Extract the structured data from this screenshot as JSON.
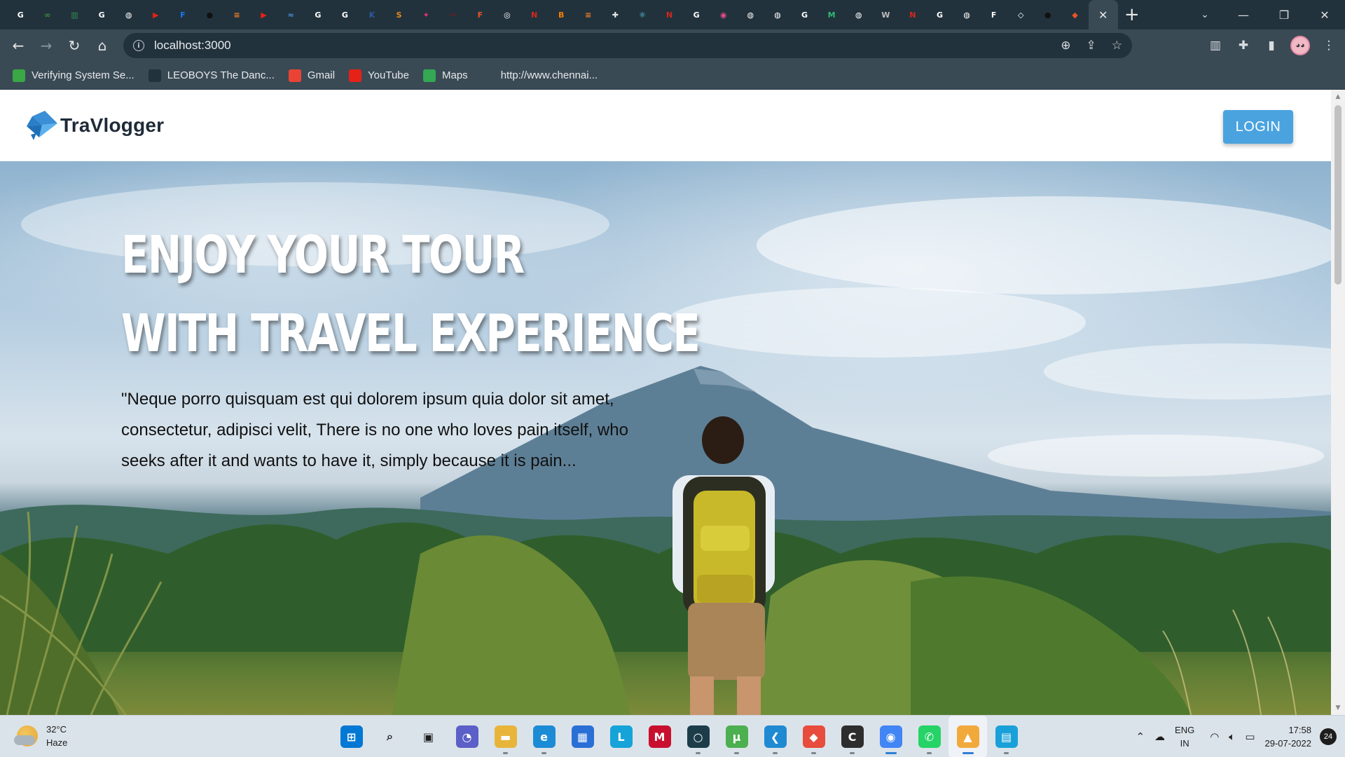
{
  "browser": {
    "tab_favicons": [
      {
        "icon": "google-icon",
        "color": "#ffffff",
        "glyph": "G"
      },
      {
        "icon": "infinity-icon",
        "color": "#3a8f3a",
        "glyph": "∞"
      },
      {
        "icon": "chart-icon",
        "color": "#2f8f4f",
        "glyph": "▥"
      },
      {
        "icon": "google-icon",
        "color": "#ffffff",
        "glyph": "G"
      },
      {
        "icon": "globe-icon",
        "color": "#ffffff",
        "glyph": "◍"
      },
      {
        "icon": "youtube-icon",
        "color": "#e62117",
        "glyph": "▶"
      },
      {
        "icon": "f-icon",
        "color": "#1877f2",
        "glyph": "F"
      },
      {
        "icon": "github-icon",
        "color": "#111111",
        "glyph": "●"
      },
      {
        "icon": "stackoverflow-icon",
        "color": "#f48024",
        "glyph": "≡"
      },
      {
        "icon": "youtube-icon",
        "color": "#e62117",
        "glyph": "▶"
      },
      {
        "icon": "wave-icon",
        "color": "#4a8fd8",
        "glyph": "≈"
      },
      {
        "icon": "google-icon",
        "color": "#ffffff",
        "glyph": "G"
      },
      {
        "icon": "google-icon",
        "color": "#ffffff",
        "glyph": "G"
      },
      {
        "icon": "kp-icon",
        "color": "#2c5aa0",
        "glyph": "K"
      },
      {
        "icon": "sp-icon",
        "color": "#e38b1c",
        "glyph": "S"
      },
      {
        "icon": "bird-icon",
        "color": "#e8336d",
        "glyph": "✦"
      },
      {
        "icon": "dots-icon",
        "color": "#7a1a1a",
        "glyph": "⋯"
      },
      {
        "icon": "fsg-icon",
        "color": "#e8542a",
        "glyph": "F"
      },
      {
        "icon": "chrome-icon",
        "color": "#ffffff",
        "glyph": "◎"
      },
      {
        "icon": "n-icon",
        "color": "#d8261c",
        "glyph": "N"
      },
      {
        "icon": "blogger-icon",
        "color": "#f57c00",
        "glyph": "B"
      },
      {
        "icon": "stackoverflow-icon",
        "color": "#f48024",
        "glyph": "≡"
      },
      {
        "icon": "puzzle-icon",
        "color": "#e6e6e6",
        "glyph": "✚"
      },
      {
        "icon": "react-icon",
        "color": "#61dafb",
        "glyph": "⚛"
      },
      {
        "icon": "n-icon",
        "color": "#d8261c",
        "glyph": "N"
      },
      {
        "icon": "google-icon",
        "color": "#ffffff",
        "glyph": "G"
      },
      {
        "icon": "dribbble-icon",
        "color": "#ea4c89",
        "glyph": "◉"
      },
      {
        "icon": "globe-icon",
        "color": "#ffffff",
        "glyph": "◍"
      },
      {
        "icon": "globe-icon",
        "color": "#ffffff",
        "glyph": "◍"
      },
      {
        "icon": "google-icon",
        "color": "#ffffff",
        "glyph": "G"
      },
      {
        "icon": "m-icon",
        "color": "#2eb872",
        "glyph": "M"
      },
      {
        "icon": "globe-icon",
        "color": "#ffffff",
        "glyph": "◍"
      },
      {
        "icon": "w-icon",
        "color": "#bdbdbd",
        "glyph": "W"
      },
      {
        "icon": "n-icon",
        "color": "#d8261c",
        "glyph": "N"
      },
      {
        "icon": "google-icon",
        "color": "#ffffff",
        "glyph": "G"
      },
      {
        "icon": "globe-icon",
        "color": "#ffffff",
        "glyph": "◍"
      },
      {
        "icon": "f-box-icon",
        "color": "#ffffff",
        "glyph": "F"
      },
      {
        "icon": "codepen-icon",
        "color": "#ffffff",
        "glyph": "◇"
      },
      {
        "icon": "github-icon",
        "color": "#111111",
        "glyph": "●"
      },
      {
        "icon": "diamond-icon",
        "color": "#e8542a",
        "glyph": "◆"
      }
    ],
    "active_tab_close": "✕",
    "new_tab": "+",
    "url": "localhost:3000",
    "bookmarks": [
      {
        "label": "Verifying System Se...",
        "icon": "chart-icon",
        "color": "#39a845"
      },
      {
        "label": "LEOBOYS The Danc...",
        "icon": "react-icon",
        "color": "#22323c"
      },
      {
        "label": "Gmail",
        "icon": "gmail-icon",
        "color": "#ea4335"
      },
      {
        "label": "YouTube",
        "icon": "youtube-icon",
        "color": "#e62117"
      },
      {
        "label": "Maps",
        "icon": "maps-icon",
        "color": "#34a853"
      },
      {
        "label": "http://www.chennai...",
        "icon": "globe-icon",
        "color": "#3a4a55"
      }
    ]
  },
  "site": {
    "brand": "TraVlogger",
    "login_label": "LOGIN",
    "hero": {
      "title_line1": "ENJOY YOUR TOUR",
      "title_line2": "WITH TRAVEL EXPERIENCE",
      "description": "\"Neque porro quisquam est qui dolorem ipsum quia dolor sit amet, consectetur, adipisci velit, There is no one who loves pain itself, who seeks after it and wants to have it, simply because it is pain..."
    },
    "colors": {
      "accent": "#4aa3df",
      "brand_text": "#1f2a37"
    }
  },
  "taskbar": {
    "weather_temp": "32°C",
    "weather_desc": "Haze",
    "apps": [
      {
        "icon": "windows-start-icon",
        "color": "#0078d4",
        "glyph": "⊞",
        "state": ""
      },
      {
        "icon": "search-icon",
        "color": "#1d1d1d",
        "glyph": "⌕",
        "state": ""
      },
      {
        "icon": "task-view-icon",
        "color": "#1d1d1d",
        "glyph": "▣",
        "state": ""
      },
      {
        "icon": "teams-chat-icon",
        "color": "#5b5fc7",
        "glyph": "◔",
        "state": ""
      },
      {
        "icon": "file-explorer-icon",
        "color": "#e8b53a",
        "glyph": "▬",
        "state": "open"
      },
      {
        "icon": "edge-icon",
        "color": "#1c8bd6",
        "glyph": "e",
        "state": "open"
      },
      {
        "icon": "store-icon",
        "color": "#2a6fd6",
        "glyph": "▦",
        "state": ""
      },
      {
        "icon": "l-app-icon",
        "color": "#15a3d8",
        "glyph": "L",
        "state": ""
      },
      {
        "icon": "mcafee-icon",
        "color": "#c8102e",
        "glyph": "M",
        "state": ""
      },
      {
        "icon": "cortana-icon",
        "color": "#1d3c4a",
        "glyph": "○",
        "state": "open"
      },
      {
        "icon": "utorrent-icon",
        "color": "#4caf50",
        "glyph": "µ",
        "state": "open"
      },
      {
        "icon": "vscode-icon",
        "color": "#1f8ad2",
        "glyph": "❮",
        "state": "open"
      },
      {
        "icon": "git-app-icon",
        "color": "#e74c3c",
        "glyph": "◆",
        "state": "open"
      },
      {
        "icon": "code-app-icon",
        "color": "#2d2d2d",
        "glyph": "C",
        "state": "open"
      },
      {
        "icon": "chrome-icon",
        "color": "#4285f4",
        "glyph": "◉",
        "state": "running"
      },
      {
        "icon": "whatsapp-icon",
        "color": "#25d366",
        "glyph": "✆",
        "state": "open"
      },
      {
        "icon": "photos-icon",
        "color": "#f2a93b",
        "glyph": "▲",
        "state": "running-active"
      },
      {
        "icon": "notepad-icon",
        "color": "#1aa0d8",
        "glyph": "▤",
        "state": "open"
      }
    ],
    "lang_top": "ENG",
    "lang_bottom": "IN",
    "time": "17:58",
    "date": "29-07-2022",
    "notifications": "24"
  }
}
